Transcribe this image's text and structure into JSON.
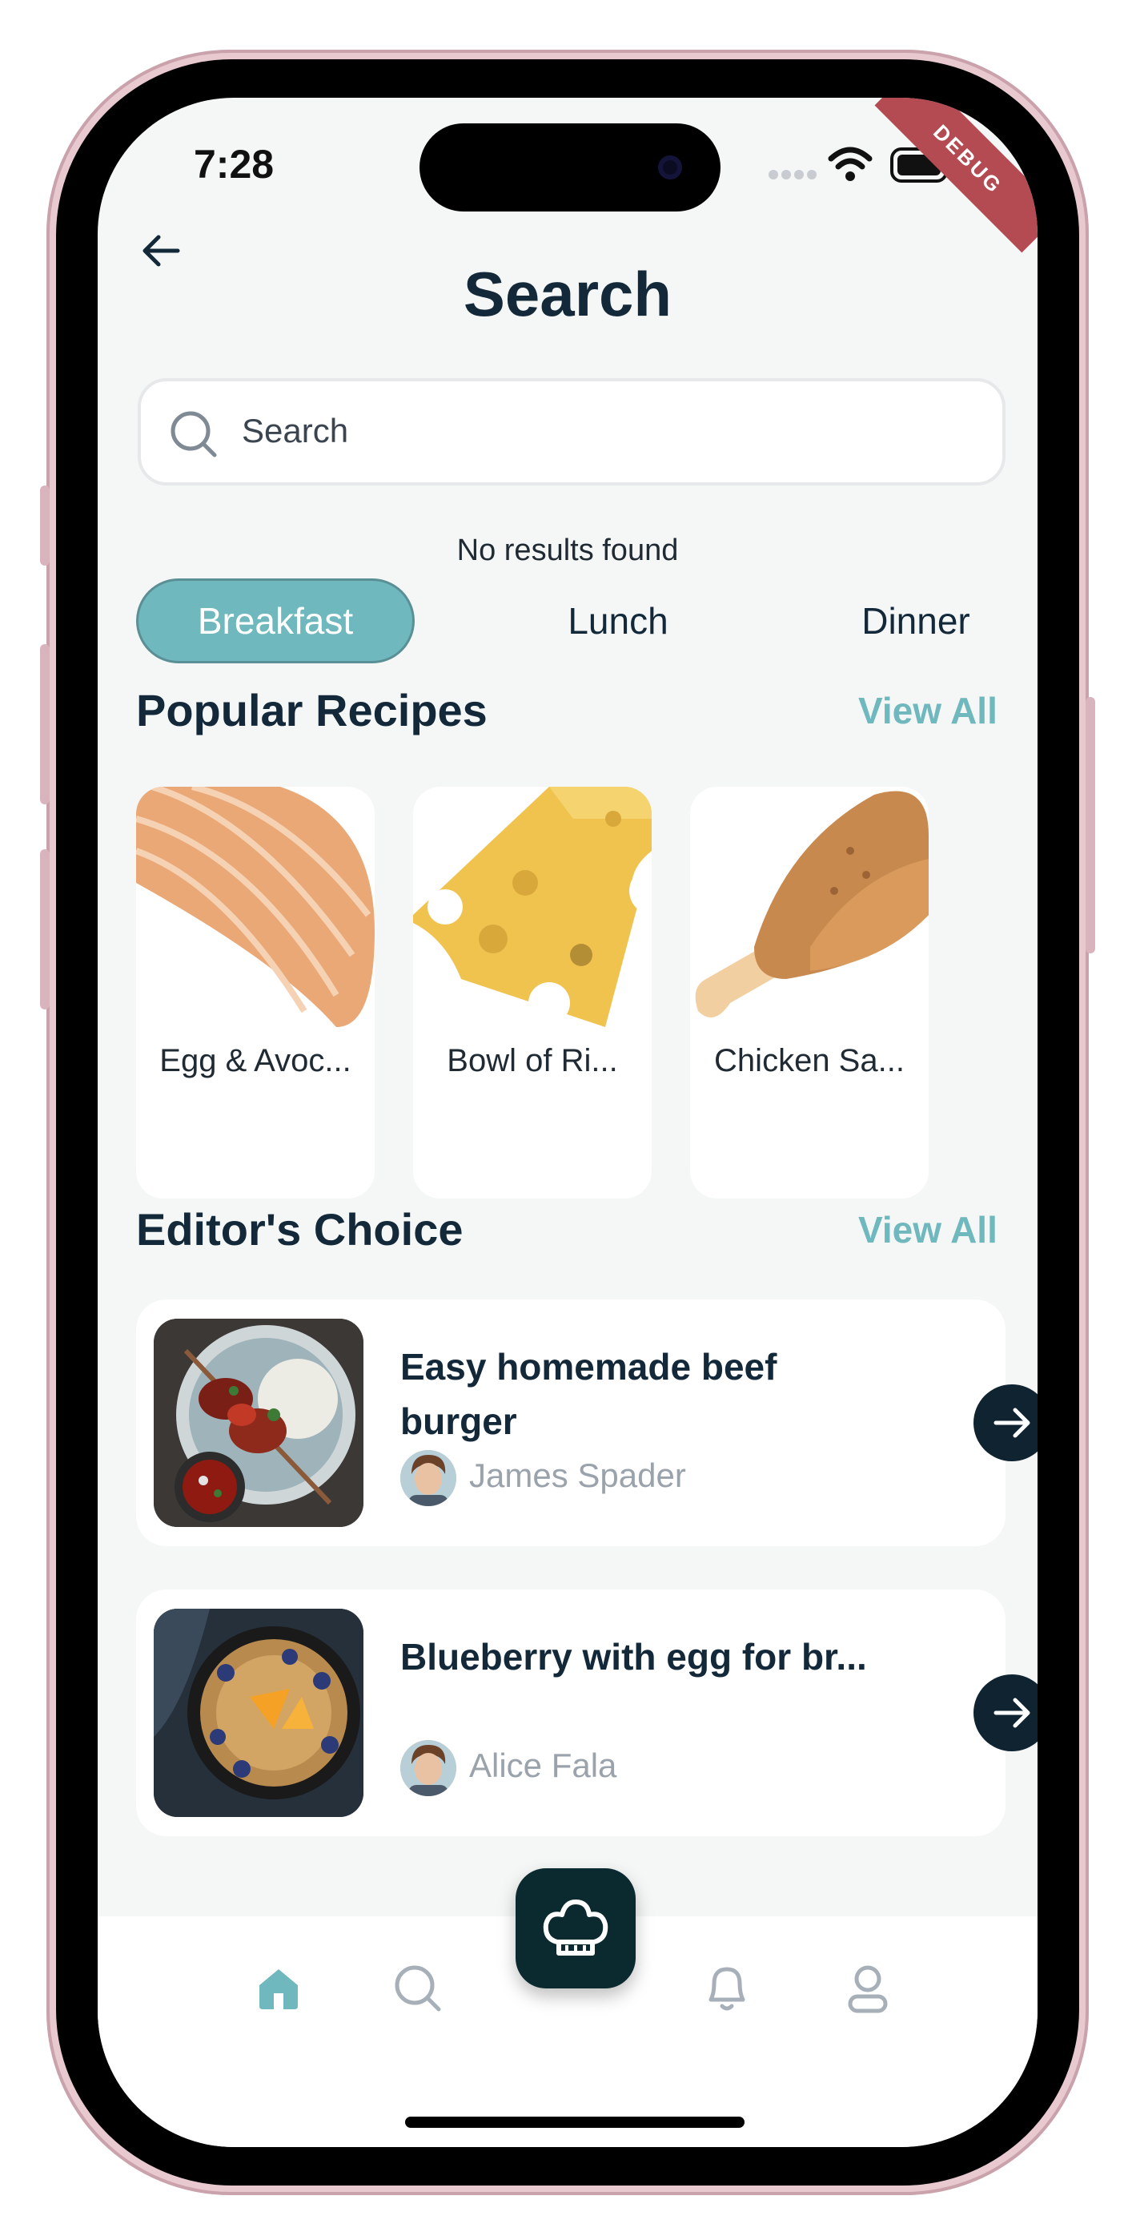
{
  "status_bar": {
    "time": "7:28",
    "debug_banner": "DEBUG"
  },
  "header": {
    "title": "Search",
    "back_icon": "arrow-left-icon"
  },
  "search": {
    "placeholder": "Search",
    "icon": "search-icon"
  },
  "message": "No results found",
  "categories": [
    {
      "label": "Breakfast",
      "selected": true
    },
    {
      "label": "Lunch",
      "selected": false
    },
    {
      "label": "Dinner",
      "selected": false
    }
  ],
  "popular": {
    "title": "Popular Recipes",
    "view_all": "View All",
    "items": [
      {
        "label": "Egg & Avoc...",
        "image": "salmon-icon"
      },
      {
        "label": "Bowl of Ri...",
        "image": "cheese-icon"
      },
      {
        "label": "Chicken Sa...",
        "image": "chicken-leg-icon"
      }
    ]
  },
  "editors_choice": {
    "title": "Editor's Choice",
    "view_all": "View All",
    "items": [
      {
        "title": "Easy homemade beef burger",
        "author": "James Spader"
      },
      {
        "title": "Blueberry with egg for br...",
        "author": "Alice Fala"
      }
    ]
  },
  "bottom_nav": {
    "items": [
      "home-icon",
      "search-icon",
      "chef-hat-icon",
      "bell-icon",
      "profile-icon"
    ],
    "active": "home-icon"
  },
  "colors": {
    "accent": "#6fb8bd",
    "dark": "#13293a",
    "fab": "#0b2a30",
    "debug": "#b44a52"
  }
}
